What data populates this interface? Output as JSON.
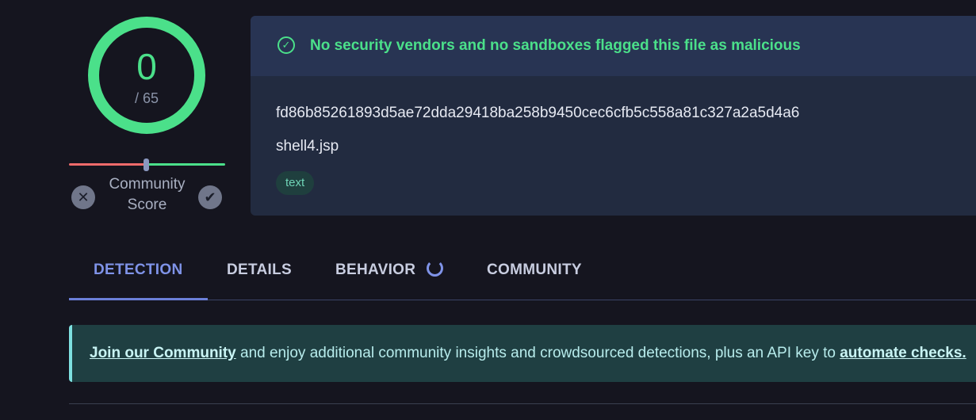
{
  "score": {
    "detections": "0",
    "total": "/ 65",
    "detection_fraction": 0,
    "ring_color": "#4be08a"
  },
  "community_score": {
    "label_line1": "Community",
    "label_line2": "Score",
    "position": 0.5,
    "downvote_icon": "close-icon",
    "upvote_icon": "check-icon"
  },
  "file": {
    "verdict": "No security vendors and no sandboxes flagged this file as malicious",
    "verdict_color": "#4be08a",
    "hash": "fd86b85261893d5ae72dda29418ba258b9450cec6cfb5c558a81c327a2a5d4a6",
    "name": "shell4.jsp",
    "tag": "text"
  },
  "tabs": [
    {
      "label": "DETECTION",
      "active": true
    },
    {
      "label": "DETAILS",
      "active": false
    },
    {
      "label": "BEHAVIOR",
      "active": false,
      "loading": true
    },
    {
      "label": "COMMUNITY",
      "active": false
    }
  ],
  "banner": {
    "link1": "Join our Community",
    "text": " and enjoy additional community insights and crowdsourced detections, plus an API key to ",
    "link2": "automate checks."
  },
  "accent_color": "#7f93e8"
}
